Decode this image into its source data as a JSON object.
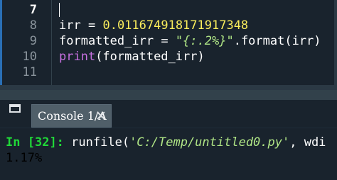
{
  "editor": {
    "current_line": "7",
    "lines": [
      {
        "number": "7"
      },
      {
        "number": "8",
        "var": "irr",
        "eq": "=",
        "value": "0.011674918171917348"
      },
      {
        "number": "9",
        "var": "formatted_irr",
        "eq": "=",
        "string": "\"{:.2%}\"",
        "rest": ".format(irr)"
      },
      {
        "number": "10",
        "func": "print",
        "args": "(formatted_irr)"
      },
      {
        "number": "11"
      }
    ]
  },
  "tabs": {
    "console_label": "Console 1/A",
    "close_icon": "close-icon",
    "pane_icon": "window-icon"
  },
  "console": {
    "prompt_open": "In [",
    "prompt_num": "32",
    "prompt_close": "]:",
    "command": "runfile(",
    "command_arg": "'C:/Temp/untitled0.py'",
    "command_rest": ", wdi",
    "output": "1.17%"
  },
  "colors": {
    "background": "#19232d",
    "number": "#faed5c",
    "string": "#b0e686",
    "builtin": "#c670e0",
    "prompt": "#20d838",
    "tab_bg": "#505f69"
  }
}
